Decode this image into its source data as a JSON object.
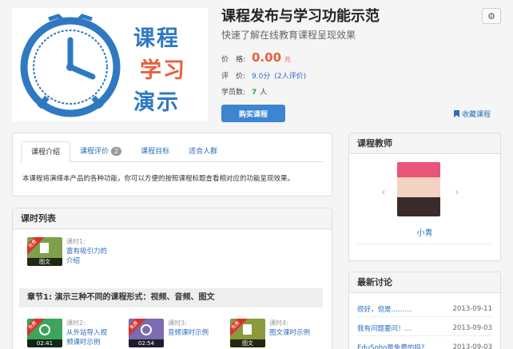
{
  "cover": {
    "line1": "课程",
    "line2": "学习",
    "line3": "演示"
  },
  "course": {
    "title": "课程发布与学习功能示范",
    "subtitle": "快速了解在线教育课程呈现效果",
    "price_label": "价　格:",
    "price_value": "0.00",
    "price_unit": "元",
    "rating_label": "评　价:",
    "rating_value": "9.0分",
    "rating_count": "(2人评价)",
    "students_label": "学员数:",
    "students_value": "7",
    "students_unit": "人",
    "buy_label": "购买课程",
    "favorite_label": "收藏课程"
  },
  "tabs": [
    {
      "label": "课程介绍"
    },
    {
      "label": "课程评价",
      "badge": "2"
    },
    {
      "label": "课程目标"
    },
    {
      "label": "适合人群"
    }
  ],
  "intro_text": "本课程将演绎本产品的各种功能，你可以方便的按照课程标题查看相对应的功能呈现效果。",
  "lessons_panel": {
    "title": "课时列表",
    "lesson1": {
      "ribbon": "免费",
      "type": "图文",
      "num": "课时1:",
      "name": "富有吸引力的介绍"
    },
    "chapter": "章节1: 演示三种不同的课程形式：视频、音频、图文",
    "lesson2": {
      "ribbon": "免费",
      "duration": "02:41",
      "num": "课时2:",
      "name": "从外站导入视频课时示例"
    },
    "lesson3": {
      "ribbon": "免费",
      "duration": "02:54",
      "num": "课时3:",
      "name": "音频课时示例"
    },
    "lesson4": {
      "ribbon": "免费",
      "type": "图文",
      "num": "课时4:",
      "name": "图文课时示例"
    }
  },
  "teacher_panel": {
    "title": "课程教师",
    "name": "小青",
    "prev": "‹",
    "next": "›"
  },
  "discussion_panel": {
    "title": "最新讨论",
    "items": [
      {
        "title": "很好，但是………",
        "date": "2013-09-11"
      },
      {
        "title": "我有问题要问！…",
        "date": "2013-09-03"
      },
      {
        "title": "EduSoho是免费的吗?",
        "date": "2013-09-03"
      }
    ]
  },
  "icons": {
    "settings": "gear-icon",
    "favorite": "bookmark-icon"
  },
  "colors": {
    "accent": "#3b85d1",
    "price": "#e8603c",
    "link": "#2a6ebb",
    "ribbon": "#d9312b"
  }
}
